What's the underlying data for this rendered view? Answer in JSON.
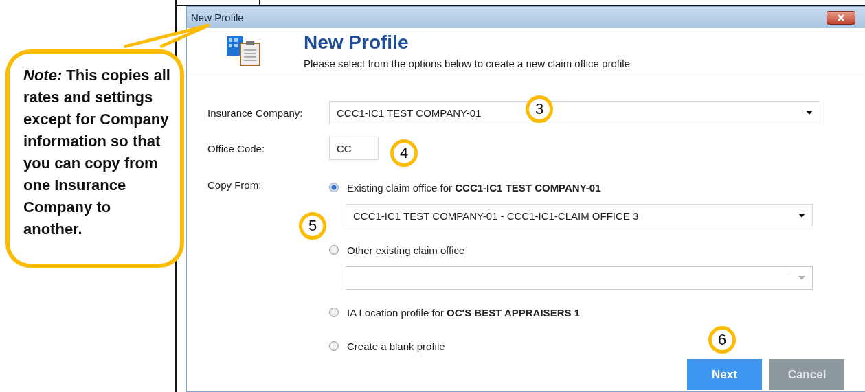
{
  "window": {
    "title": "New Profile"
  },
  "header": {
    "title": "New Profile",
    "subtitle": "Please select from the options below to create a new claim office profile"
  },
  "insurance_company": {
    "label": "Insurance Company:",
    "value": "CCC1-IC1 TEST COMPANY-01",
    "marker": "3"
  },
  "office_code": {
    "label": "Office Code:",
    "value": "CC",
    "marker": "4"
  },
  "copy_from": {
    "label": "Copy From:",
    "options": [
      {
        "label": "Existing claim office for **CCC1-IC1 TEST COMPANY-01**",
        "selected": true,
        "dropdown": {
          "value": "CCC1-IC1 TEST COMPANY-01 - CCC1-IC1-CLAIM OFFICE 3",
          "disabled": false,
          "marker": "5"
        }
      },
      {
        "label": "Other existing claim office",
        "selected": false,
        "dropdown": {
          "disabled": true
        }
      },
      {
        "label": "IA Location profile for **OC'S BEST APPRAISERS 1**",
        "selected": false
      },
      {
        "label": "Create a blank profile",
        "selected": false
      }
    ]
  },
  "buttons": [
    {
      "label": "Next",
      "kind": "primary",
      "marker": "6"
    },
    {
      "label": "Cancel",
      "kind": "secondary"
    }
  ],
  "note": {
    "text": "*Note:*  This copies all rates and settings except for Company information so that you can copy from one Insurance Company to another."
  }
}
